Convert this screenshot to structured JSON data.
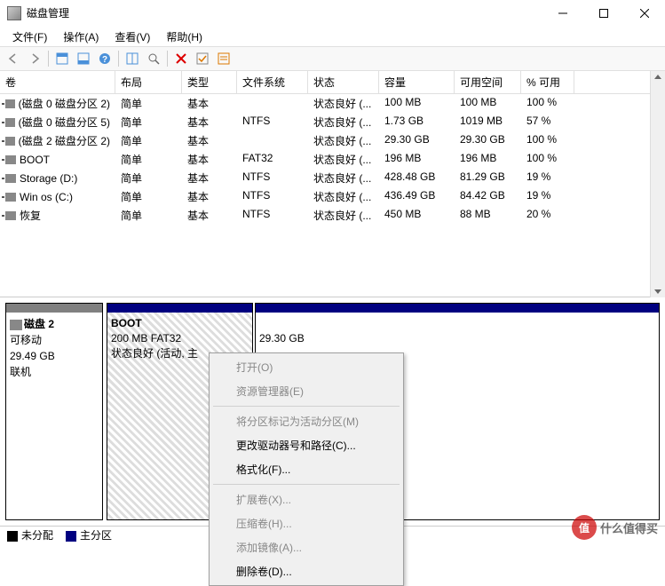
{
  "window": {
    "title": "磁盘管理"
  },
  "menu": {
    "file": "文件(F)",
    "action": "操作(A)",
    "view": "查看(V)",
    "help": "帮助(H)"
  },
  "columns": {
    "volume": "卷",
    "layout": "布局",
    "type": "类型",
    "fs": "文件系统",
    "status": "状态",
    "capacity": "容量",
    "free": "可用空间",
    "pct": "% 可用"
  },
  "volumes": [
    {
      "name": "(磁盘 0 磁盘分区 2)",
      "layout": "简单",
      "type": "基本",
      "fs": "",
      "status": "状态良好 (...",
      "cap": "100 MB",
      "free": "100 MB",
      "pct": "100 %"
    },
    {
      "name": "(磁盘 0 磁盘分区 5)",
      "layout": "简单",
      "type": "基本",
      "fs": "NTFS",
      "status": "状态良好 (...",
      "cap": "1.73 GB",
      "free": "1019 MB",
      "pct": "57 %"
    },
    {
      "name": "(磁盘 2 磁盘分区 2)",
      "layout": "简单",
      "type": "基本",
      "fs": "",
      "status": "状态良好 (...",
      "cap": "29.30 GB",
      "free": "29.30 GB",
      "pct": "100 %"
    },
    {
      "name": "BOOT",
      "layout": "简单",
      "type": "基本",
      "fs": "FAT32",
      "status": "状态良好 (...",
      "cap": "196 MB",
      "free": "196 MB",
      "pct": "100 %"
    },
    {
      "name": "Storage (D:)",
      "layout": "简单",
      "type": "基本",
      "fs": "NTFS",
      "status": "状态良好 (...",
      "cap": "428.48 GB",
      "free": "81.29 GB",
      "pct": "19 %"
    },
    {
      "name": "Win os  (C:)",
      "layout": "简单",
      "type": "基本",
      "fs": "NTFS",
      "status": "状态良好 (...",
      "cap": "436.49 GB",
      "free": "84.42 GB",
      "pct": "19 %"
    },
    {
      "name": "恢复",
      "layout": "简单",
      "type": "基本",
      "fs": "NTFS",
      "status": "状态良好 (...",
      "cap": "450 MB",
      "free": "88 MB",
      "pct": "20 %"
    }
  ],
  "disk": {
    "label": "磁盘 2",
    "removable": "可移动",
    "size": "29.49 GB",
    "online": "联机",
    "p0": {
      "name": "BOOT",
      "desc": "200 MB FAT32",
      "status": "状态良好 (活动, 主"
    },
    "p1": {
      "size": "29.30 GB"
    }
  },
  "legend": {
    "unalloc": "未分配",
    "primary": "主分区"
  },
  "ctx": {
    "open": "打开(O)",
    "explorer": "资源管理器(E)",
    "mark_active": "将分区标记为活动分区(M)",
    "change_drive": "更改驱动器号和路径(C)...",
    "format": "格式化(F)...",
    "extend": "扩展卷(X)...",
    "shrink": "压缩卷(H)...",
    "add_mirror": "添加镜像(A)...",
    "delete": "删除卷(D)..."
  },
  "watermark": {
    "badge": "值",
    "text": "什么值得买"
  }
}
